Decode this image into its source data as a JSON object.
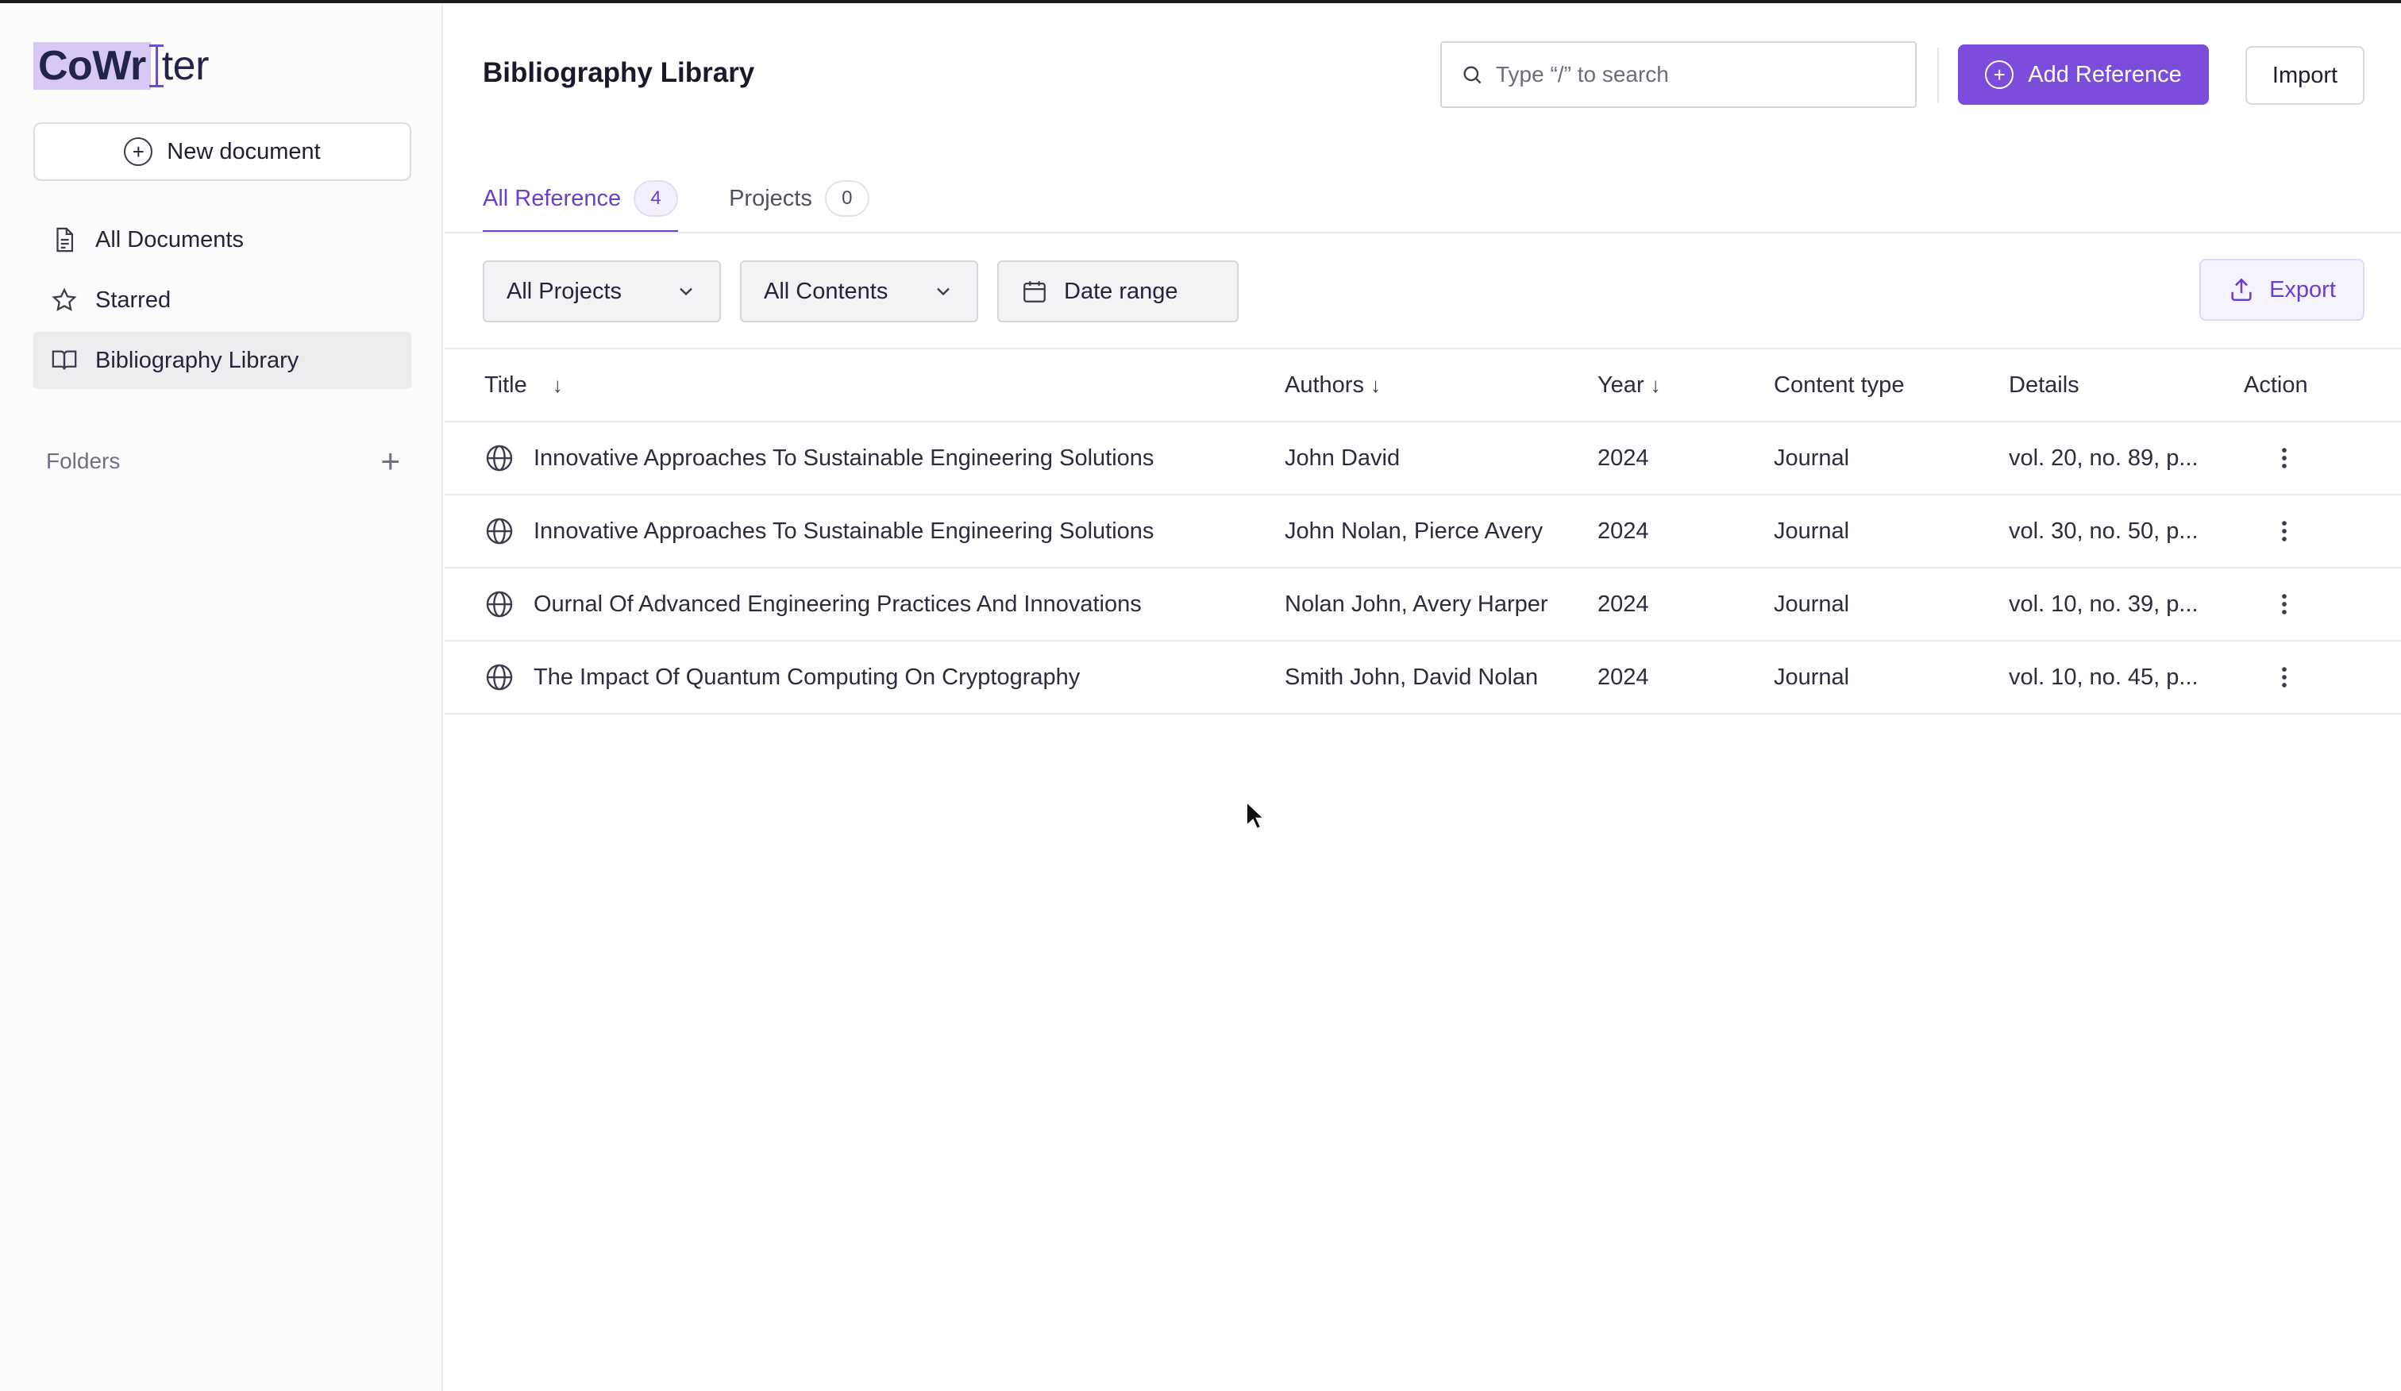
{
  "app": {
    "logo_highlight": "CoWr",
    "logo_rest": "ter"
  },
  "sidebar": {
    "new_document_label": "New document",
    "items": [
      {
        "label": "All Documents",
        "icon": "document-icon"
      },
      {
        "label": "Starred",
        "icon": "star-icon"
      },
      {
        "label": "Bibliography Library",
        "icon": "book-open-icon",
        "active": true
      }
    ],
    "folders_label": "Folders",
    "folders_add": "+"
  },
  "header": {
    "title": "Bibliography Library",
    "search_placeholder": "Type “/” to search",
    "add_reference_label": "Add Reference",
    "import_label": "Import"
  },
  "tabs": [
    {
      "label": "All Reference",
      "count": "4",
      "active": true
    },
    {
      "label": "Projects",
      "count": "0",
      "active": false
    }
  ],
  "filters": {
    "projects": "All Projects",
    "contents": "All Contents",
    "date_range": "Date range",
    "export_label": "Export"
  },
  "table": {
    "columns": {
      "title": "Title",
      "authors": "Authors",
      "year": "Year",
      "content_type": "Content type",
      "details": "Details",
      "action": "Action"
    },
    "rows": [
      {
        "title": "Innovative Approaches To Sustainable Engineering Solutions",
        "authors": "John David",
        "year": "2024",
        "content_type": "Journal",
        "details": "vol. 20, no. 89, p..."
      },
      {
        "title": "Innovative Approaches To Sustainable Engineering Solutions",
        "authors": "John Nolan, Pierce Avery",
        "year": "2024",
        "content_type": "Journal",
        "details": "vol. 30, no. 50, p..."
      },
      {
        "title": "Ournal Of Advanced Engineering Practices And Innovations",
        "authors": "Nolan John, Avery Harper",
        "year": "2024",
        "content_type": "Journal",
        "details": "vol. 10, no. 39, p..."
      },
      {
        "title": "The Impact Of Quantum Computing On Cryptography",
        "authors": "Smith John, David Nolan",
        "year": "2024",
        "content_type": "Journal",
        "details": "vol. 10, no. 45, p..."
      }
    ]
  },
  "colors": {
    "accent": "#7c4dda",
    "accent_text": "#6a3fd0",
    "active_nav_bg": "#ededf0"
  }
}
